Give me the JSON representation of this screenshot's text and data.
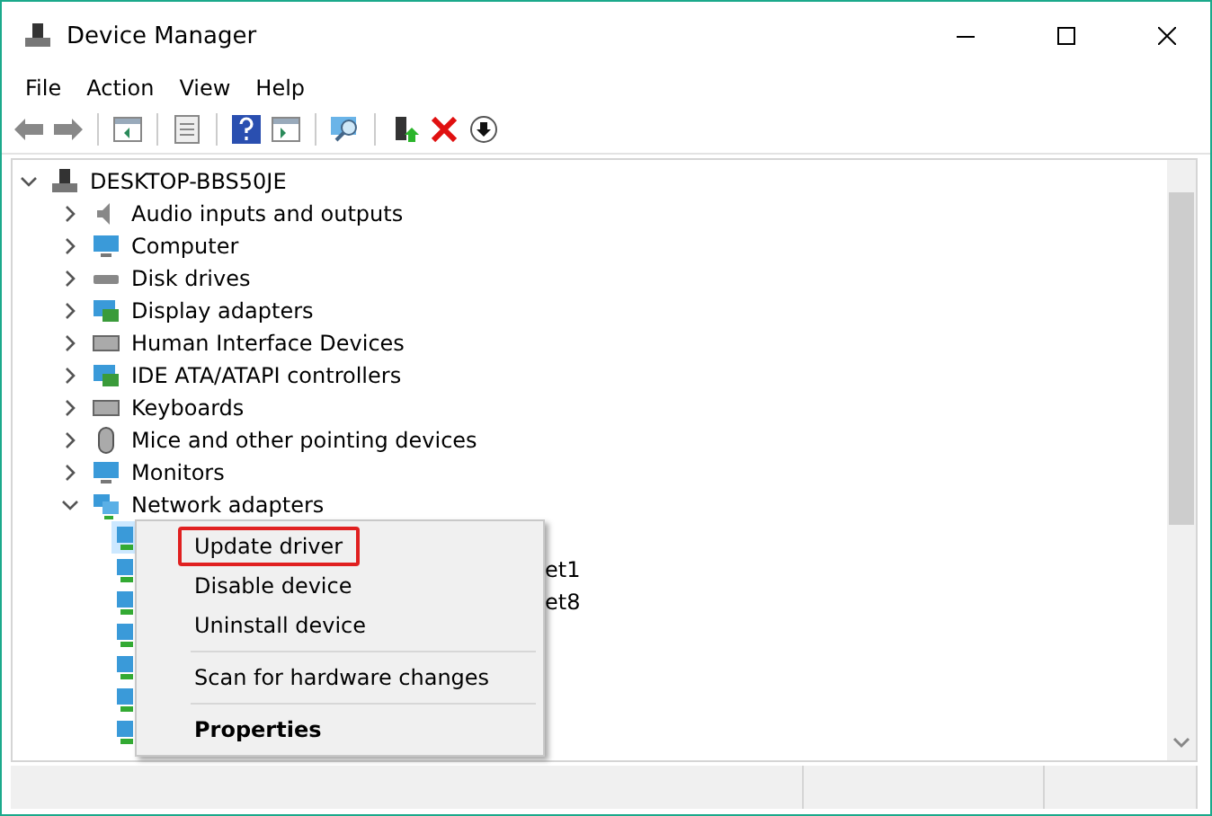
{
  "window": {
    "title": "Device Manager"
  },
  "menu": [
    "File",
    "Action",
    "View",
    "Help"
  ],
  "tree": {
    "label": "DESKTOP-BBS50JE",
    "expanded": true,
    "children": [
      {
        "label": "Audio inputs and outputs",
        "expanded": false
      },
      {
        "label": "Computer",
        "expanded": false
      },
      {
        "label": "Disk drives",
        "expanded": false
      },
      {
        "label": "Display adapters",
        "expanded": false
      },
      {
        "label": "Human Interface Devices",
        "expanded": false
      },
      {
        "label": "IDE ATA/ATAPI controllers",
        "expanded": false
      },
      {
        "label": "Keyboards",
        "expanded": false
      },
      {
        "label": "Mice and other pointing devices",
        "expanded": false
      },
      {
        "label": "Monitors",
        "expanded": false
      },
      {
        "label": "Network adapters",
        "expanded": true,
        "children": [
          {
            "selected": true
          },
          {
            "label": "et1",
            "selected": false
          },
          {
            "label": "et8",
            "selected": false
          },
          {
            "selected": false
          },
          {
            "selected": false
          },
          {
            "selected": false
          },
          {
            "selected": false
          }
        ]
      }
    ]
  },
  "context_menu": [
    {
      "kind": "item",
      "label": "Update driver",
      "highlighted": true
    },
    {
      "kind": "item",
      "label": "Disable device",
      "highlighted": false
    },
    {
      "kind": "item",
      "label": "Uninstall device",
      "highlighted": false
    },
    {
      "kind": "separator"
    },
    {
      "kind": "item",
      "label": "Scan for hardware changes",
      "highlighted": false
    },
    {
      "kind": "separator"
    },
    {
      "kind": "default",
      "label": "Properties",
      "highlighted": false
    }
  ]
}
